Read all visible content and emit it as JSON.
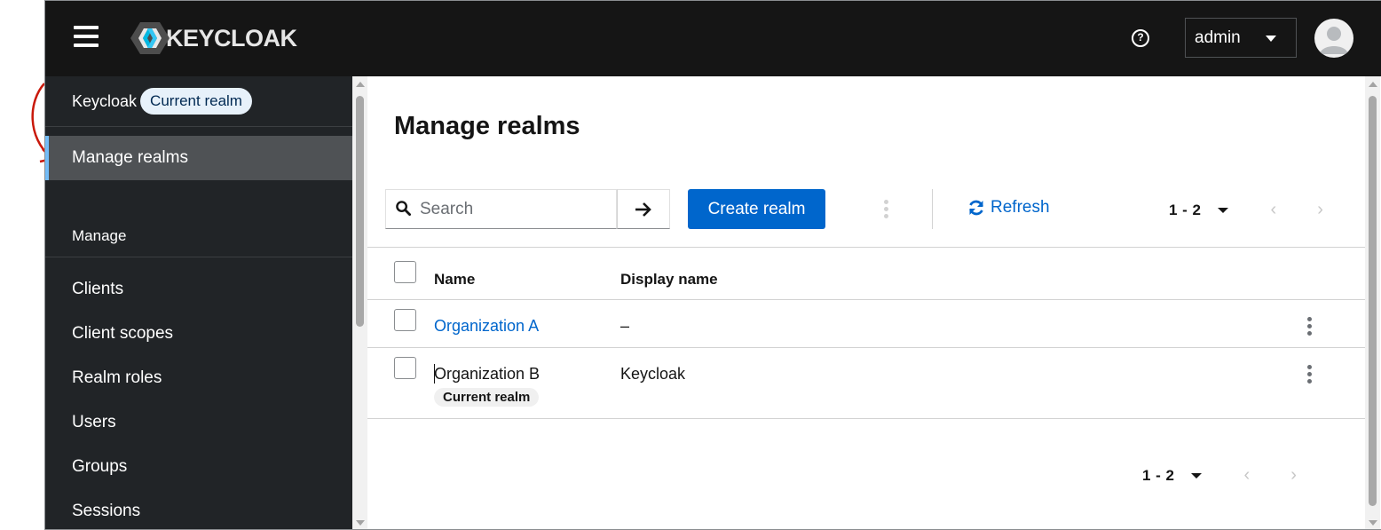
{
  "header": {
    "brand": "KEYCLOAK",
    "user": "admin",
    "icons": [
      "hamburger-menu-icon",
      "help-icon",
      "caret-down-icon",
      "avatar-icon"
    ]
  },
  "sidebar": {
    "realm_name": "Keycloak",
    "realm_badge": "Current realm",
    "active_item": "Manage realms",
    "section_label": "Manage",
    "items": [
      "Clients",
      "Client scopes",
      "Realm roles",
      "Users",
      "Groups",
      "Sessions"
    ]
  },
  "main": {
    "title": "Manage realms",
    "search_placeholder": "Search",
    "create_button": "Create realm",
    "refresh_label": "Refresh",
    "pager_range": "1 - 2",
    "table": {
      "columns": [
        "Name",
        "Display name"
      ],
      "rows": [
        {
          "name": "Organization A",
          "display_name": "–",
          "is_link": true,
          "badge": ""
        },
        {
          "name": "Organization B",
          "display_name": "Keycloak",
          "is_link": false,
          "badge": "Current realm"
        }
      ]
    }
  },
  "colors": {
    "masthead": "#151515",
    "sidebar": "#212427",
    "primary": "#0066cc",
    "active_nav": "#4f5255",
    "annotation_arrow": "#c9190b"
  }
}
